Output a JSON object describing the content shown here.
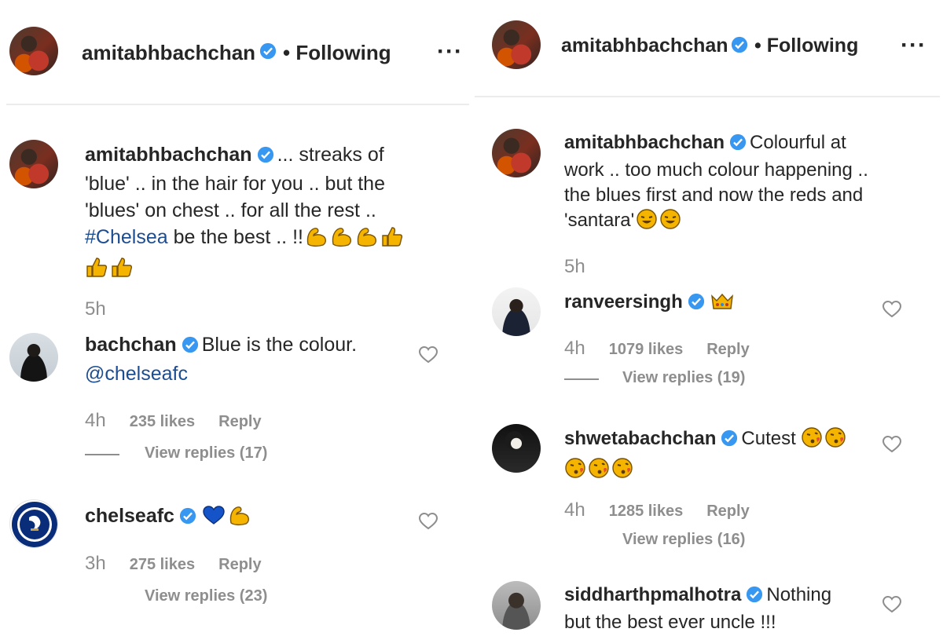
{
  "left": {
    "header": {
      "username": "amitabhbachchan",
      "following": "• Following",
      "more": "···"
    },
    "caption": {
      "username": "amitabhbachchan",
      "line1": "... streaks of",
      "line2": "'blue' .. in the hair for you .. but the",
      "line3": "'blues' on chest .. for all the rest ..",
      "hashtag": "#Chelsea",
      "line4_rest": " be the best .. !!",
      "time": "5h"
    },
    "comments": [
      {
        "username": "bachchan",
        "text": "Blue is the colour.",
        "mention": "@chelseafc",
        "time": "4h",
        "likes": "235 likes",
        "reply": "Reply",
        "view_replies": "View replies (17)"
      },
      {
        "username": "chelseafc",
        "time": "3h",
        "likes": "275 likes",
        "reply": "Reply",
        "view_replies": "View replies (23)"
      }
    ]
  },
  "right": {
    "header": {
      "username": "amitabhbachchan",
      "following": "• Following",
      "more": "···"
    },
    "caption": {
      "username": "amitabhbachchan",
      "line1": "Colourful at",
      "line2": "work .. too much colour happening ..",
      "line3": "the blues first and now the reds and",
      "line4": "'santara'",
      "time": "5h"
    },
    "comments": [
      {
        "username": "ranveersingh",
        "time": "4h",
        "likes": "1079 likes",
        "reply": "Reply",
        "view_replies": "View replies (19)"
      },
      {
        "username": "shwetabachchan",
        "text": "Cutest",
        "time": "4h",
        "likes": "1285 likes",
        "reply": "Reply",
        "view_replies": "View replies (16)"
      },
      {
        "username": "siddharthpmalhotra",
        "text1": "Nothing",
        "text2": "but the best ever uncle !!!"
      }
    ]
  },
  "colors": {
    "verified": "#3897f0",
    "hashtag": "#1d4d91",
    "muted": "#8e8e8e",
    "emoji": "#f4b400"
  },
  "icons": [
    "verified-badge-icon",
    "more-options-icon",
    "heart-icon",
    "flexed-biceps-icon",
    "thumbs-up-icon",
    "blue-heart-icon",
    "crown-icon",
    "laughing-face-icon",
    "kissing-face-icon",
    "chelsea-crest-icon"
  ]
}
